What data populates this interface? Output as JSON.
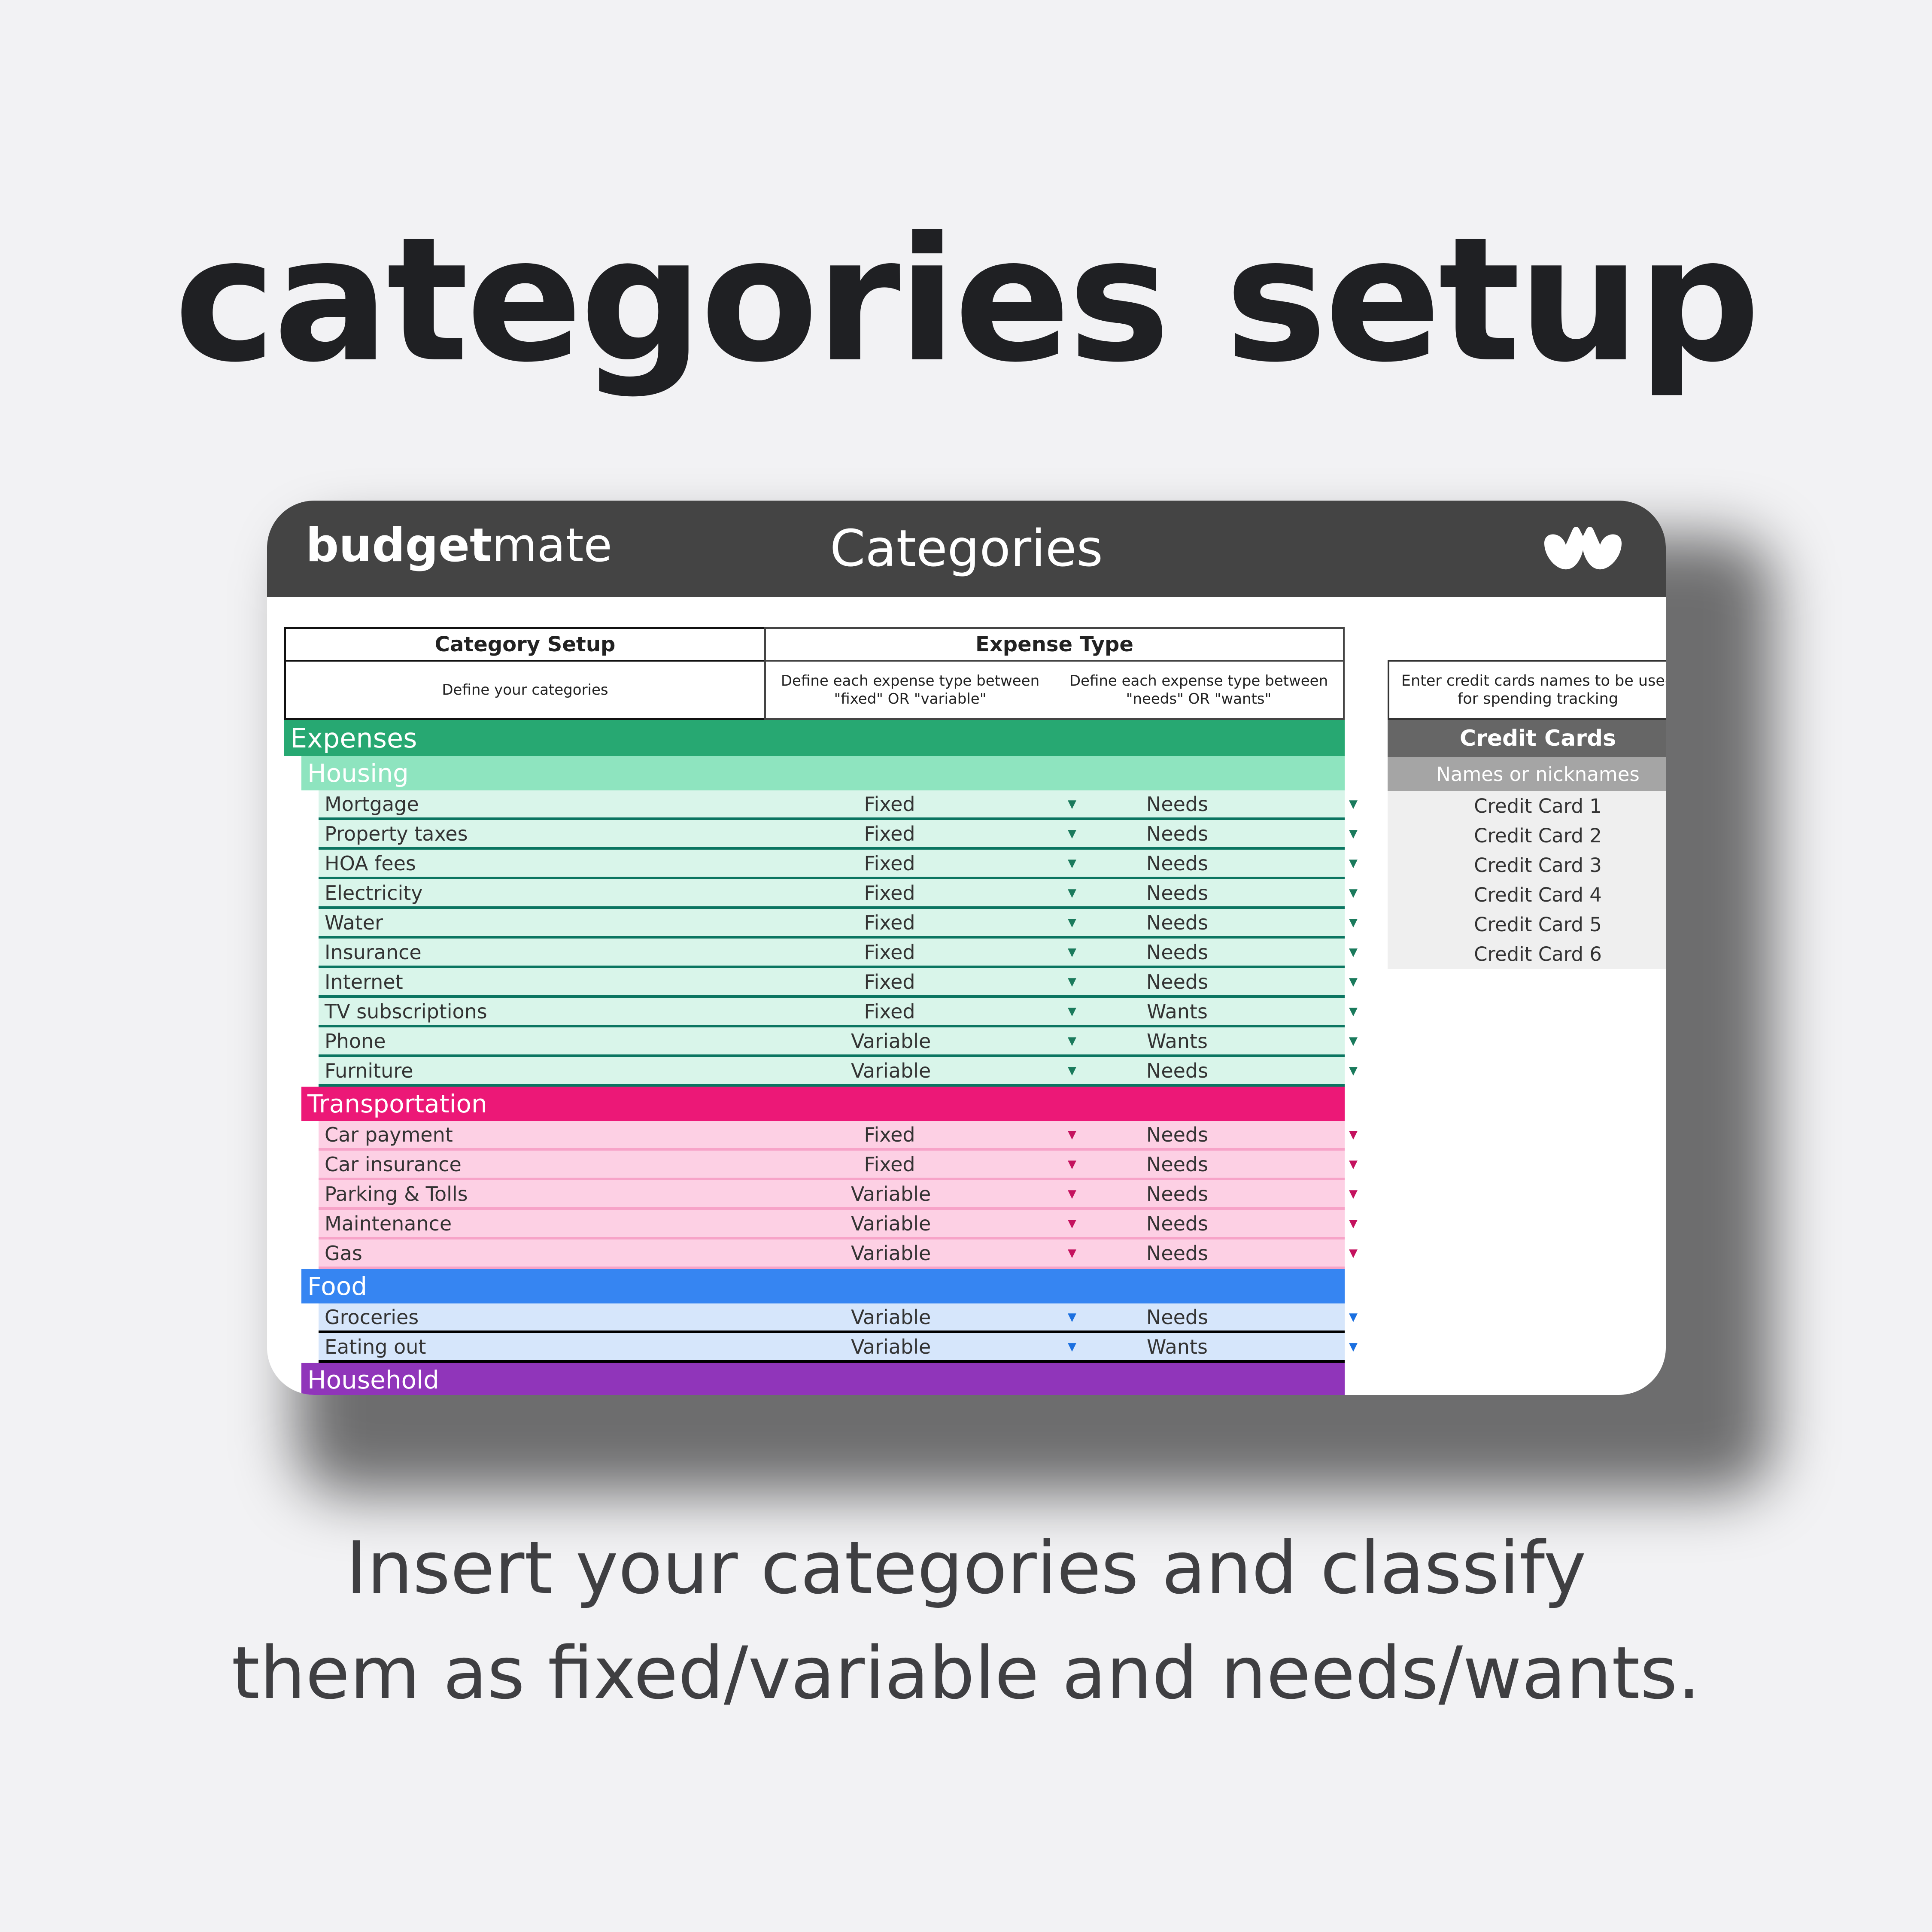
{
  "headline": "categories setup",
  "caption": {
    "line1": "Insert your categories and classify",
    "line2": "them as fixed/variable and needs/wants."
  },
  "window": {
    "brand_bold": "budget",
    "brand_light": "mate",
    "title": "Categories",
    "logo_icon": "budgetmate-logo-icon"
  },
  "table": {
    "header": {
      "category_setup": "Category Setup",
      "expense_type": "Expense Type",
      "category_hint": "Define your categories",
      "fixed_variable_hint": "Define each expense type between \"fixed\" OR \"variable\"",
      "needs_wants_hint": "Define each expense type between \"needs\" OR \"wants\""
    },
    "section": "Expenses",
    "groups": [
      {
        "name": "Housing",
        "band_color": "#8ee4bf",
        "row_color": "#d9f5ea",
        "line_color": "#0b7561",
        "arrow_color": "#1a7a5c",
        "rows": [
          {
            "name": "Mortgage",
            "fixed_variable": "Fixed",
            "needs_wants": "Needs"
          },
          {
            "name": "Property taxes",
            "fixed_variable": "Fixed",
            "needs_wants": "Needs"
          },
          {
            "name": "HOA fees",
            "fixed_variable": "Fixed",
            "needs_wants": "Needs"
          },
          {
            "name": "Electricity",
            "fixed_variable": "Fixed",
            "needs_wants": "Needs"
          },
          {
            "name": "Water",
            "fixed_variable": "Fixed",
            "needs_wants": "Needs"
          },
          {
            "name": "Insurance",
            "fixed_variable": "Fixed",
            "needs_wants": "Needs"
          },
          {
            "name": "Internet",
            "fixed_variable": "Fixed",
            "needs_wants": "Needs"
          },
          {
            "name": "TV subscriptions",
            "fixed_variable": "Fixed",
            "needs_wants": "Wants"
          },
          {
            "name": "Phone",
            "fixed_variable": "Variable",
            "needs_wants": "Wants"
          },
          {
            "name": "Furniture",
            "fixed_variable": "Variable",
            "needs_wants": "Needs"
          }
        ]
      },
      {
        "name": "Transportation",
        "band_color": "#ec1877",
        "row_color": "#fdd0e4",
        "line_color": "#f7a3c8",
        "arrow_color": "#c4125e",
        "rows": [
          {
            "name": "Car payment",
            "fixed_variable": "Fixed",
            "needs_wants": "Needs"
          },
          {
            "name": "Car insurance",
            "fixed_variable": "Fixed",
            "needs_wants": "Needs"
          },
          {
            "name": "Parking & Tolls",
            "fixed_variable": "Variable",
            "needs_wants": "Needs"
          },
          {
            "name": "Maintenance",
            "fixed_variable": "Variable",
            "needs_wants": "Needs"
          },
          {
            "name": "Gas",
            "fixed_variable": "Variable",
            "needs_wants": "Needs"
          }
        ]
      },
      {
        "name": "Food",
        "band_color": "#3685f2",
        "row_color": "#d6e6fb",
        "line_color": "#000000",
        "arrow_color": "#1a6fe0",
        "rows": [
          {
            "name": "Groceries",
            "fixed_variable": "Variable",
            "needs_wants": "Needs"
          },
          {
            "name": "Eating out",
            "fixed_variable": "Variable",
            "needs_wants": "Wants"
          }
        ]
      },
      {
        "name": "Household",
        "band_color": "#9035ba",
        "row_color": "#ead6f3",
        "line_color": "#9035ba",
        "arrow_color": "#9035ba",
        "rows": []
      }
    ],
    "section_color": "#27a872"
  },
  "credit_cards": {
    "note": "Enter credit cards names to be used for spending tracking",
    "title": "Credit Cards",
    "subtitle": "Names or nicknames",
    "items": [
      "Credit Card 1",
      "Credit Card 2",
      "Credit Card 3",
      "Credit Card 4",
      "Credit Card 5",
      "Credit Card 6"
    ]
  }
}
